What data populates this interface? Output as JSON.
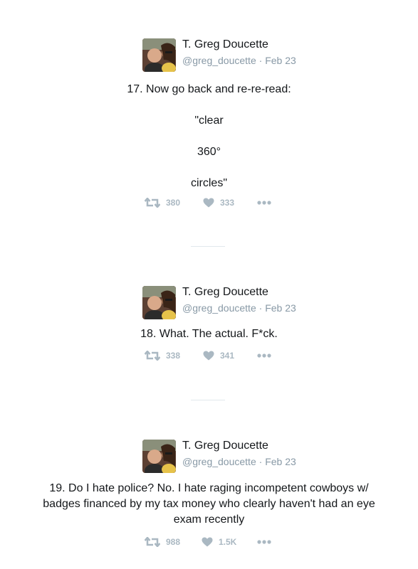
{
  "tweets": [
    {
      "name": "T. Greg Doucette",
      "handle": "@greg_doucette",
      "separator": "·",
      "date": "Feb 23",
      "lines": [
        "17. Now go back and re-re-read:",
        "\"clear",
        "360°",
        "circles\""
      ],
      "retweets": "380",
      "likes": "333"
    },
    {
      "name": "T. Greg Doucette",
      "handle": "@greg_doucette",
      "separator": "·",
      "date": "Feb 23",
      "lines": [
        "18. What. The actual. F*ck."
      ],
      "retweets": "338",
      "likes": "341"
    },
    {
      "name": "T. Greg Doucette",
      "handle": "@greg_doucette",
      "separator": "·",
      "date": "Feb 23",
      "lines": [
        "19. Do I hate police? No. I hate raging incompetent cowboys w/",
        "badges financed by my tax money who clearly haven't had an eye",
        "exam recently"
      ],
      "retweets": "988",
      "likes": "1.5K"
    }
  ],
  "icons": {
    "retweet": "retweet-icon",
    "like": "heart-icon",
    "more": "more-icon"
  },
  "colors": {
    "action_gray": "#aab8c2",
    "meta_gray": "#8899a6",
    "divider": "#e1e8ed"
  }
}
